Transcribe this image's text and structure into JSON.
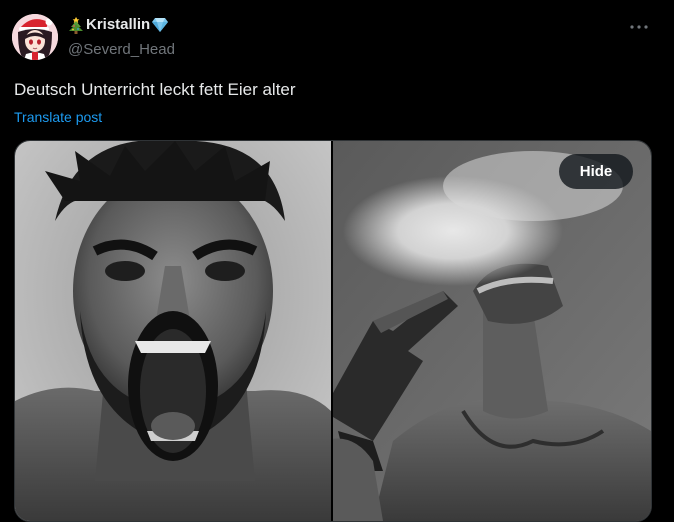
{
  "post": {
    "author": {
      "display_name": "Kristallin",
      "handle": "@Severd_Head",
      "avatar_icon": "avatar-anime-girl-santa-hat",
      "name_prefix_emoji_icon": "christmas-tree-icon",
      "name_suffix_emoji_icon": "gem-icon"
    },
    "more_icon": "more-horizontal-icon",
    "text": "Deutsch Unterricht leckt fett Eier alter",
    "translate_label": "Translate post",
    "media": {
      "images": [
        {
          "icon": "photo-screaming-man"
        },
        {
          "icon": "photo-man-shot-with-gun"
        }
      ],
      "hide_label": "Hide"
    }
  },
  "colors": {
    "background": "#000000",
    "text_primary": "#e7e9ea",
    "text_secondary": "#71767b",
    "link": "#1d9bf0"
  }
}
